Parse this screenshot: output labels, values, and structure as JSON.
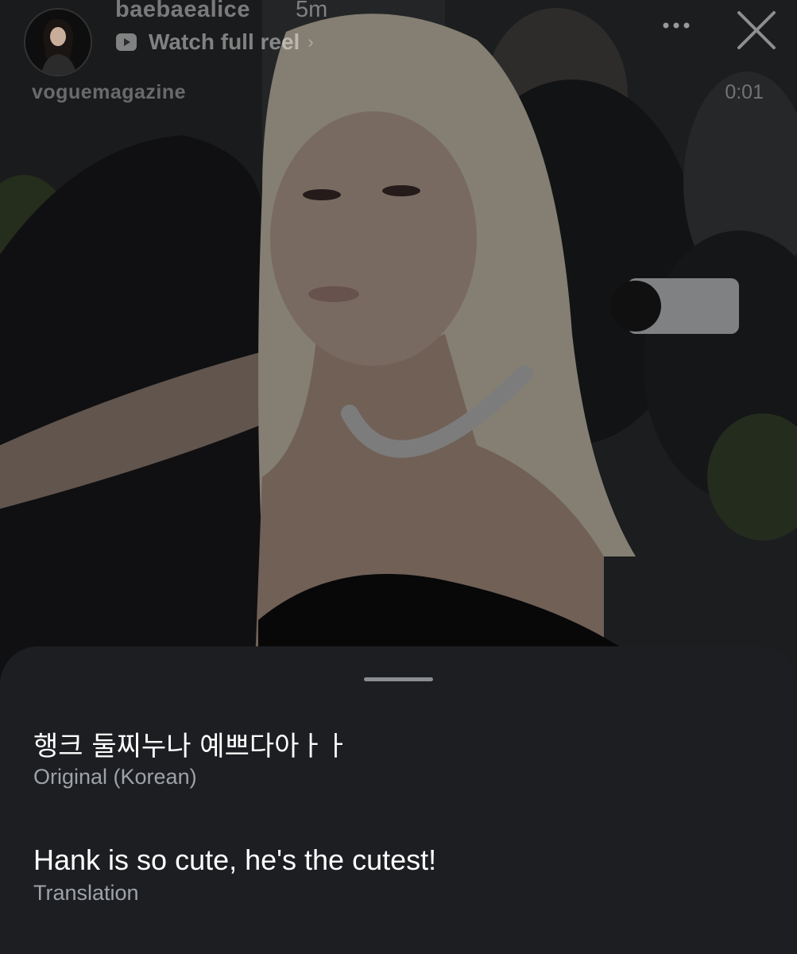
{
  "story": {
    "username": "baebaealice",
    "time_ago": "5m",
    "watch_label": "Watch full reel",
    "source_account": "voguemagazine",
    "duration": "0:01"
  },
  "translation_sheet": {
    "original_text": "행크 둘찌누나 예쁘다아ㅏㅏ",
    "original_caption": "Original (Korean)",
    "translated_text": "Hank is so cute, he's the cutest!",
    "translated_caption": "Translation"
  },
  "icons": {
    "watch": "play-icon",
    "more": "more-icon",
    "close": "close-icon",
    "chevron": "chevron-right-icon"
  },
  "colors": {
    "sheet_bg": "#1c1e21",
    "caption_gray": "#9fa3a8",
    "handle": "#8a8d91"
  }
}
